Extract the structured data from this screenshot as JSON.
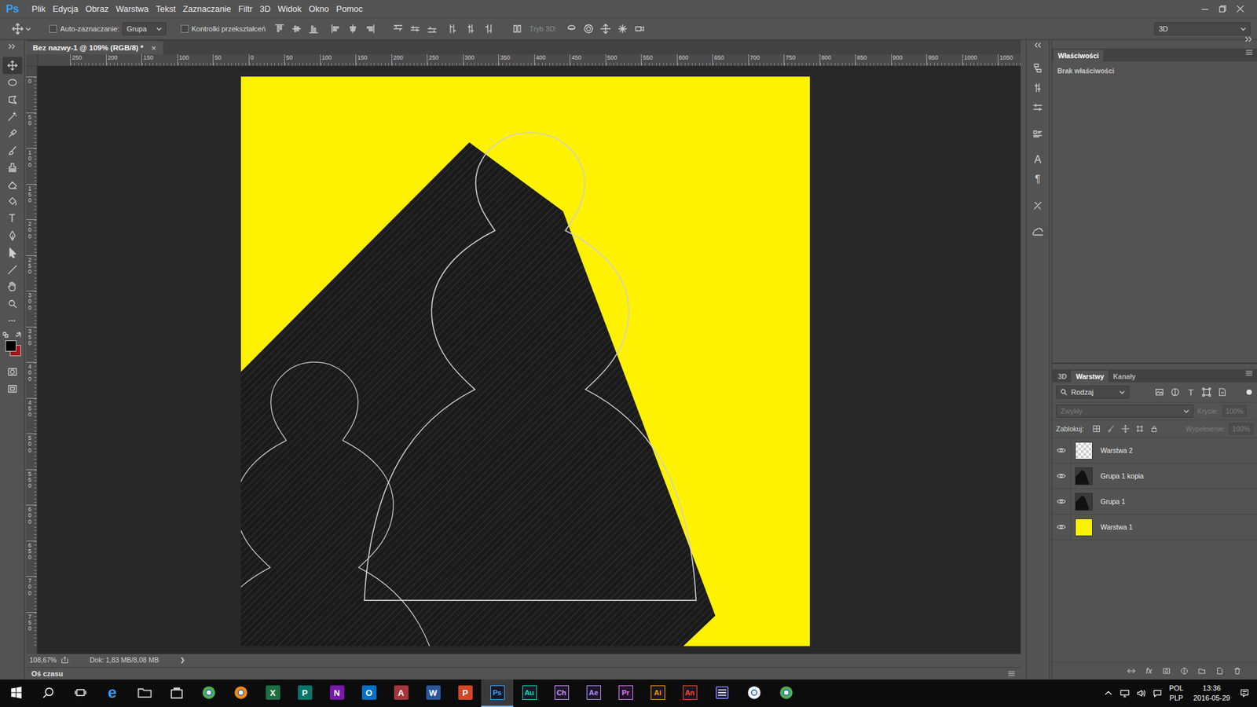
{
  "app": {
    "logo": "Ps"
  },
  "menu": [
    "Plik",
    "Edycja",
    "Obraz",
    "Warstwa",
    "Tekst",
    "Zaznaczanie",
    "Filtr",
    "3D",
    "Widok",
    "Okno",
    "Pomoc"
  ],
  "options": {
    "auto_select": {
      "label": "Auto-zaznaczanie:",
      "checked": false
    },
    "auto_select_target": "Grupa",
    "transform_controls": {
      "label": "Kontrolki przekształceń",
      "checked": false
    },
    "mode_3d": {
      "label": "Tryb 3D:",
      "disabled": true
    },
    "workspace": "3D"
  },
  "document_tab": {
    "title": "Bez nazwy-1 @ 109% (RGB/8) *",
    "close": "×",
    "selected": true
  },
  "rulers": {
    "horizontal": [
      "250",
      "200",
      "150",
      "100",
      "50",
      "0",
      "50",
      "100",
      "150",
      "200",
      "250",
      "300",
      "350",
      "400",
      "450",
      "500",
      "550",
      "600",
      "650",
      "700",
      "750",
      "800",
      "850",
      "900",
      "950",
      "1000",
      "1050"
    ],
    "vertical": [
      "0",
      "50",
      "100",
      "150",
      "200",
      "250",
      "300",
      "350",
      "400",
      "450",
      "500",
      "550",
      "600",
      "650",
      "700",
      "750"
    ]
  },
  "tools": [
    {
      "selected": true
    },
    {
      "selected": false
    },
    {
      "selected": false
    },
    {
      "selected": false
    },
    {
      "selected": false
    },
    {
      "selected": false
    },
    {
      "selected": false
    },
    {
      "selected": false
    },
    {
      "selected": false
    },
    {
      "glyph": "T",
      "selected": false
    },
    {
      "selected": false
    },
    {
      "selected": false
    },
    {
      "selected": false
    },
    {
      "selected": false
    },
    {
      "selected": false
    },
    {
      "glyph": "•••",
      "selected": false
    }
  ],
  "swatches": {
    "foreground": "#000000",
    "background": "#a3141b"
  },
  "status": {
    "zoom": "108,67%",
    "doc": "Dok: 1,83 MB/8,08 MB",
    "arrow": "❯"
  },
  "timeline": {
    "title": "Oś czasu"
  },
  "side_strip": {
    "glyphs": [
      "A",
      "¶"
    ]
  },
  "properties": {
    "title": "Właściwości",
    "body": "Brak właściwości"
  },
  "layers_panel": {
    "tabs": [
      {
        "label": "3D",
        "selected": false
      },
      {
        "label": "Warstwy",
        "selected": true
      },
      {
        "label": "Kanały",
        "selected": false
      }
    ],
    "filter": "Rodzaj",
    "filter_glyph": "T",
    "blend": {
      "value": "Zwykły",
      "disabled": true
    },
    "opacity": {
      "label": "Krycie:",
      "value": "100%",
      "disabled": true
    },
    "lock_label": "Zablokuj:",
    "fill": {
      "label": "Wypełnienie:",
      "value": "100%",
      "disabled": true
    },
    "layers": [
      {
        "name": "Warstwa 2",
        "visible": true,
        "selected": false,
        "kind": "transparent"
      },
      {
        "name": "Grupa 1 kopia",
        "visible": true,
        "selected": false,
        "kind": "art"
      },
      {
        "name": "Grupa 1",
        "visible": true,
        "selected": false,
        "kind": "art"
      },
      {
        "name": "Warstwa 1",
        "visible": true,
        "selected": false,
        "kind": "fill",
        "color": "#fff200"
      }
    ],
    "bottom_glyph": "fx"
  },
  "taskbar": {
    "apps": [
      {
        "kind": "glyph",
        "label": "e",
        "color": "#3b9cff",
        "selected": false
      },
      {
        "kind": "folder",
        "color": "#f4c542",
        "selected": false
      },
      {
        "kind": "bag",
        "color": "#ffffff",
        "selected": false
      },
      {
        "kind": "round",
        "color": "#4caf50",
        "selected": false
      },
      {
        "kind": "round",
        "color": "#ff8a00",
        "selected": false
      },
      {
        "kind": "office",
        "label": "X",
        "color": "#1d6f42",
        "selected": false
      },
      {
        "kind": "office",
        "label": "P",
        "color": "#077568",
        "selected": false
      },
      {
        "kind": "office",
        "label": "N",
        "color": "#7719aa",
        "selected": false
      },
      {
        "kind": "office",
        "label": "O",
        "color": "#0072c6",
        "selected": false
      },
      {
        "kind": "office",
        "label": "A",
        "color": "#a4373a",
        "selected": false
      },
      {
        "kind": "office",
        "label": "W",
        "color": "#2b579a",
        "selected": false
      },
      {
        "kind": "office",
        "label": "P",
        "color": "#d24726",
        "selected": false
      },
      {
        "kind": "adobe",
        "label": "Ps",
        "color": "#31a8ff",
        "selected": true
      },
      {
        "kind": "adobe",
        "label": "Au",
        "color": "#00e4bb",
        "selected": false
      },
      {
        "kind": "adobe",
        "label": "Ch",
        "color": "#d291ff",
        "selected": false
      },
      {
        "kind": "adobe",
        "label": "Ae",
        "color": "#b98cff",
        "selected": false
      },
      {
        "kind": "adobe",
        "label": "Pr",
        "color": "#ea77ff",
        "selected": false
      },
      {
        "kind": "adobe",
        "label": "Ai",
        "color": "#ff9a00",
        "selected": false
      },
      {
        "kind": "adobe",
        "label": "An",
        "color": "#ff4b19",
        "selected": false
      },
      {
        "kind": "box",
        "color": "#8f8fff",
        "selected": false
      },
      {
        "kind": "round",
        "color": "#ffffff",
        "selected": false
      },
      {
        "kind": "round",
        "color": "#4caf50",
        "selected": false
      }
    ],
    "tray": {
      "lang": "POL",
      "layout": "PLP",
      "time": "13:36",
      "date": "2016-05-29"
    }
  }
}
